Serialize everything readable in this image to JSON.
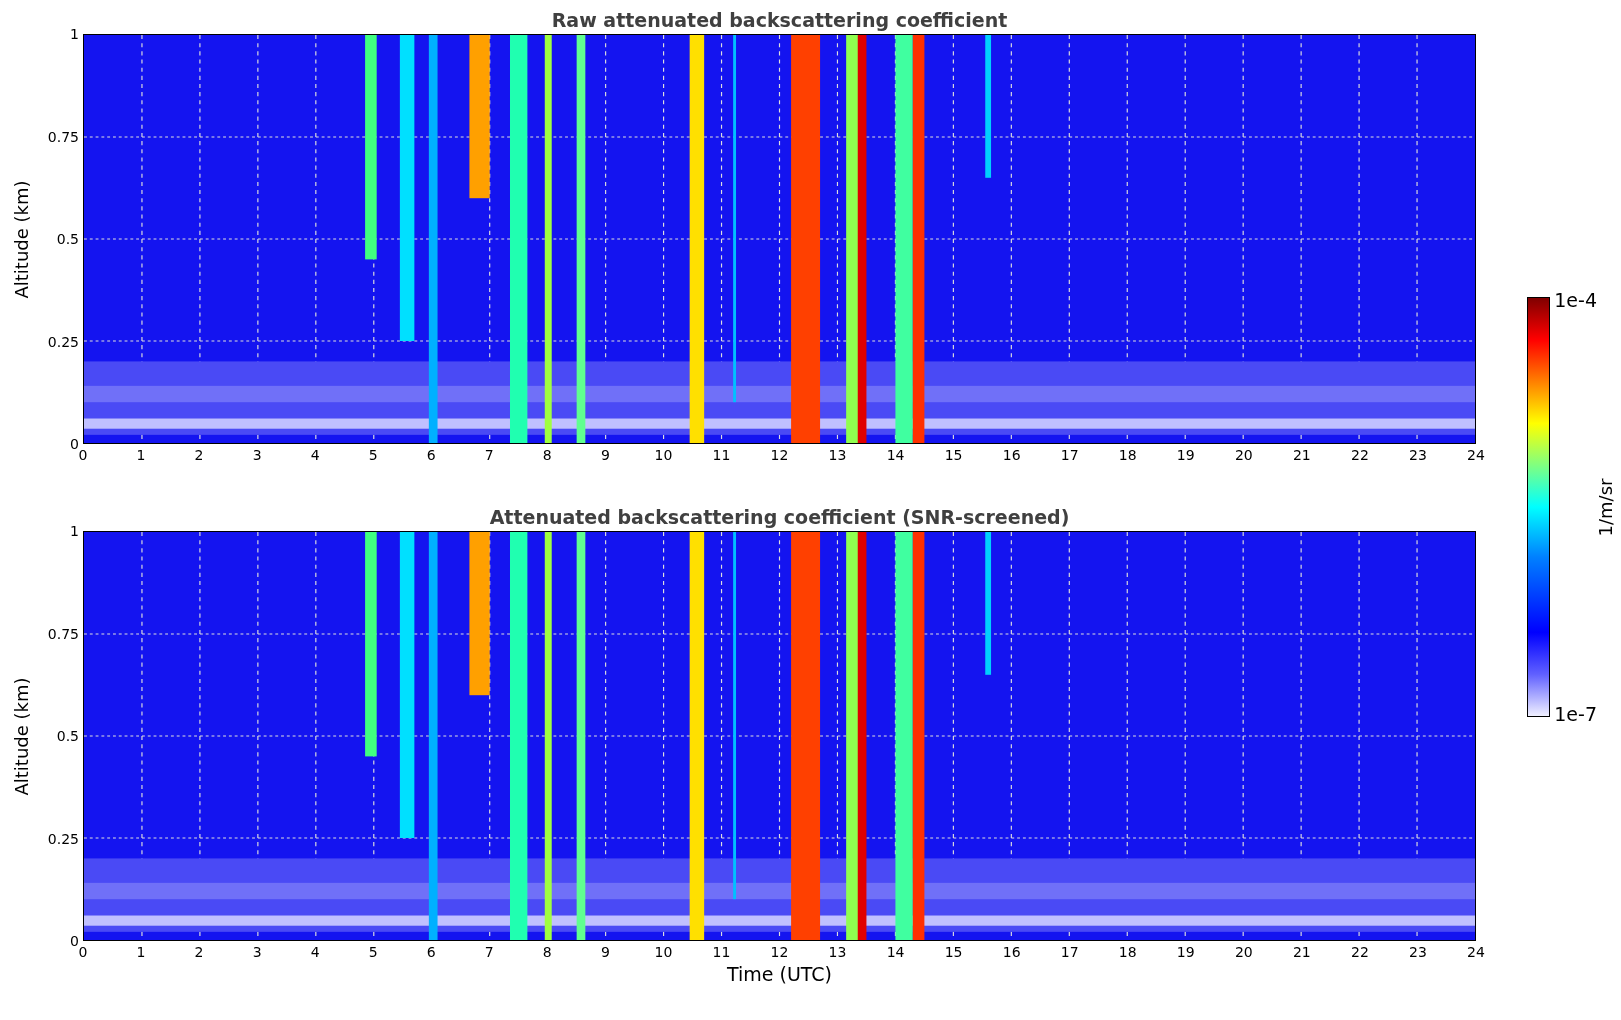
{
  "panels": [
    {
      "title": "Raw attenuated backscattering coefficient",
      "ylabel": "Altitude (km)",
      "yticks": [
        "1",
        "0.75",
        "0.5",
        "0.25",
        "0"
      ],
      "xticks": [
        "0",
        "1",
        "2",
        "3",
        "4",
        "5",
        "6",
        "7",
        "8",
        "9",
        "10",
        "11",
        "12",
        "13",
        "14",
        "15",
        "16",
        "17",
        "18",
        "19",
        "20",
        "21",
        "22",
        "23",
        "24"
      ]
    },
    {
      "title": "Attenuated backscattering coefficient (SNR-screened)",
      "ylabel": "Altitude (km)",
      "yticks": [
        "1",
        "0.75",
        "0.5",
        "0.25",
        "0"
      ],
      "xticks": [
        "0",
        "1",
        "2",
        "3",
        "4",
        "5",
        "6",
        "7",
        "8",
        "9",
        "10",
        "11",
        "12",
        "13",
        "14",
        "15",
        "16",
        "17",
        "18",
        "19",
        "20",
        "21",
        "22",
        "23",
        "24"
      ],
      "xlabel": "Time (UTC)"
    }
  ],
  "colorbar": {
    "max_label": "1e-4",
    "min_label": "1e-7",
    "label": "1/m/sr"
  }
}
